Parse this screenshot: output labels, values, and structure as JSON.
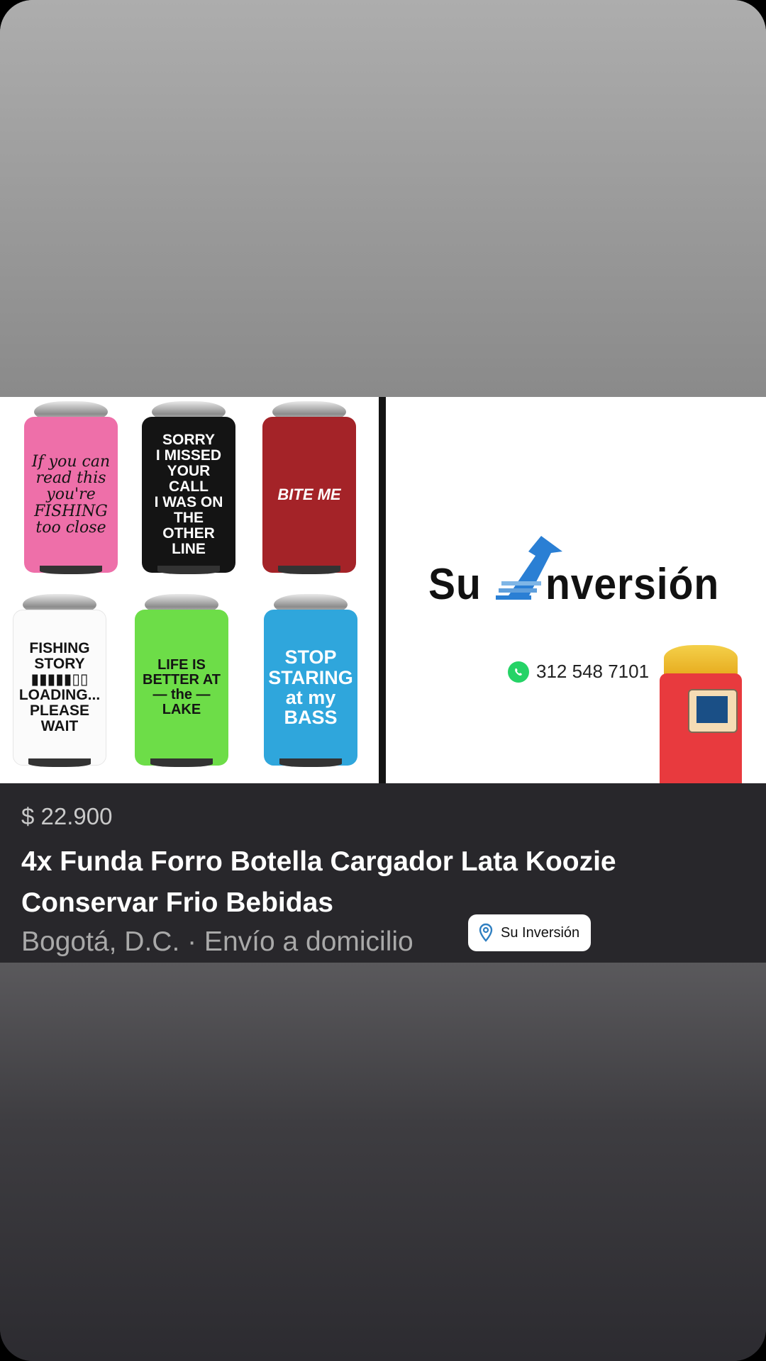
{
  "listing": {
    "price": "$ 22.900",
    "title": "4x Funda Forro Botella Cargador Lata Koozie Conservar Frio Bebidas",
    "location": "Bogotá, D.C. · Envío a domicilio",
    "store_chip": "Su Inversión"
  },
  "image": {
    "koozies": [
      {
        "text": "If you can\nread this you're\nFISHING\ntoo close",
        "color": "#ee6fa9"
      },
      {
        "text": "SORRY\nI MISSED\nYOUR CALL\nI WAS ON\nTHE OTHER\nLINE",
        "color": "#141414"
      },
      {
        "text": "BITE ME",
        "color": "#a42328"
      },
      {
        "text": "FISHING\nSTORY\n▮▮▮▮▮▯▯\nLOADING...\nPLEASE WAIT",
        "color": "#fbfbfb"
      },
      {
        "text": "LIFE IS BETTER AT\n— the —\nLAKE",
        "color": "#6ddd48"
      },
      {
        "text": "STOP\nSTARING\nat my\nBASS",
        "color": "#2fa6dc"
      }
    ],
    "brand_part1": "Su",
    "brand_part2": "nversión",
    "phone": "312 548 7101"
  },
  "icons": {
    "location": "map-pin-icon",
    "whatsapp": "whatsapp-icon"
  }
}
